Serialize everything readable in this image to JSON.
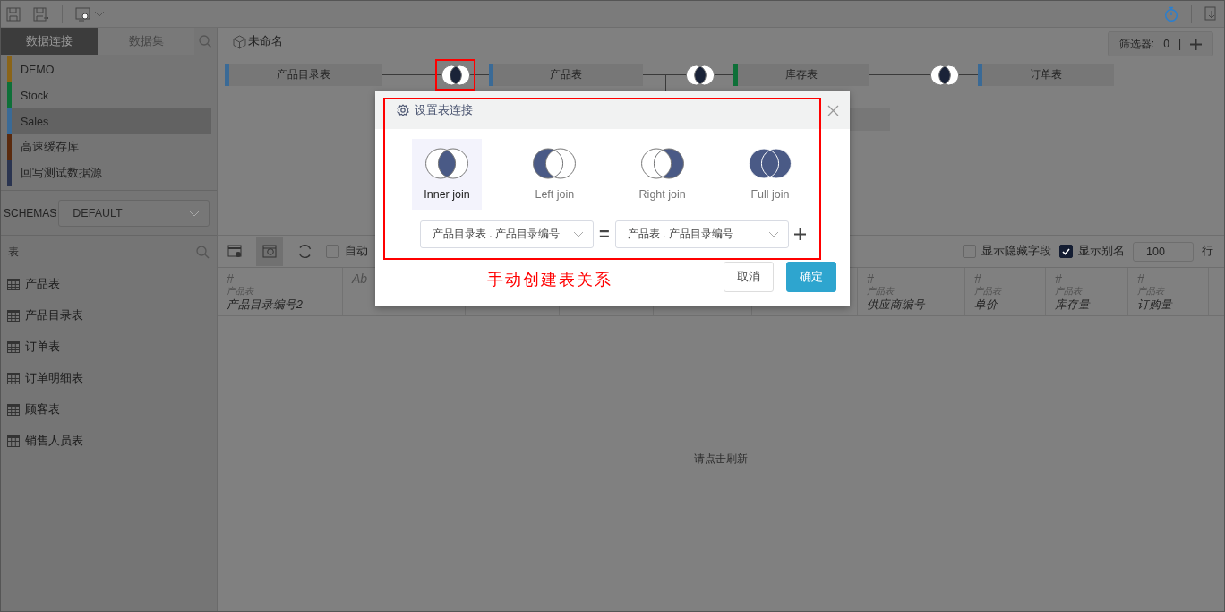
{
  "sidebar": {
    "tabs": [
      {
        "label": "数据连接",
        "selected": true
      },
      {
        "label": "数据集",
        "selected": false
      }
    ],
    "connections": [
      {
        "name": "DEMO",
        "color": "#8a6418",
        "selected": false
      },
      {
        "name": "Stock",
        "color": "#0e7038",
        "selected": false
      },
      {
        "name": "Sales",
        "color": "#3a6a96",
        "selected": true
      },
      {
        "name": "高速缓存库",
        "color": "#5a2a0e",
        "selected": false
      },
      {
        "name": "回写测试数据源",
        "color": "#2a3450",
        "selected": false
      }
    ],
    "schemas": {
      "label": "SCHEMAS",
      "value": "DEFAULT"
    },
    "tables_header": "表",
    "tables": [
      "产品表",
      "产品目录表",
      "订单表",
      "订单明细表",
      "顾客表",
      "销售人员表"
    ]
  },
  "diagram": {
    "title": "未命名",
    "filter": {
      "label": "筛选器:",
      "count": "0",
      "separator": "|"
    },
    "nodes": [
      {
        "name": "产品目录表",
        "color": "#3a6a96"
      },
      {
        "name": "产品表",
        "color": "#3a6a96"
      },
      {
        "name": "库存表",
        "color": "#0e7038"
      },
      {
        "name": "订单表",
        "color": "#3a6a96"
      }
    ],
    "joins": [
      {
        "kind": "inner",
        "highlighted": true
      },
      {
        "kind": "inner",
        "highlighted": false
      },
      {
        "kind": "inner",
        "highlighted": false
      }
    ]
  },
  "data_toolbar": {
    "auto_refresh": {
      "label": "自动",
      "checked": false
    },
    "show_hidden": {
      "label": "显示隐藏字段",
      "checked": false
    },
    "show_alias": {
      "label": "显示别名",
      "checked": true
    },
    "row_count": "100",
    "row_unit": "行"
  },
  "columns": [
    {
      "type_icon": "#",
      "table": "产品表",
      "name": "产品目录编号2"
    },
    {
      "type_icon": "Ab"
    },
    {},
    {},
    {},
    {},
    {
      "type_icon": "#",
      "table": "产品表",
      "name": "供应商编号"
    },
    {
      "type_icon": "#",
      "table": "产品表",
      "name": "单价"
    },
    {
      "type_icon": "#",
      "table": "产品表",
      "name": "库存量"
    },
    {
      "type_icon": "#",
      "table": "产品表",
      "name": "订购量"
    }
  ],
  "empty_message": "请点击刷新",
  "dialog": {
    "title": "设置表连接",
    "join_types": [
      {
        "kind": "inner",
        "label": "Inner join",
        "selected": true
      },
      {
        "kind": "left",
        "label": "Left join",
        "selected": false
      },
      {
        "kind": "right",
        "label": "Right join",
        "selected": false
      },
      {
        "kind": "full",
        "label": "Full join",
        "selected": false
      }
    ],
    "condition": {
      "left": "产品目录表 . 产品目录编号",
      "operator": "=",
      "right": "产品表 . 产品目录编号"
    },
    "buttons": [
      {
        "label": "取消",
        "kind": "secondary"
      },
      {
        "label": "确定",
        "kind": "primary"
      }
    ]
  },
  "annotation": "手动创建表关系"
}
